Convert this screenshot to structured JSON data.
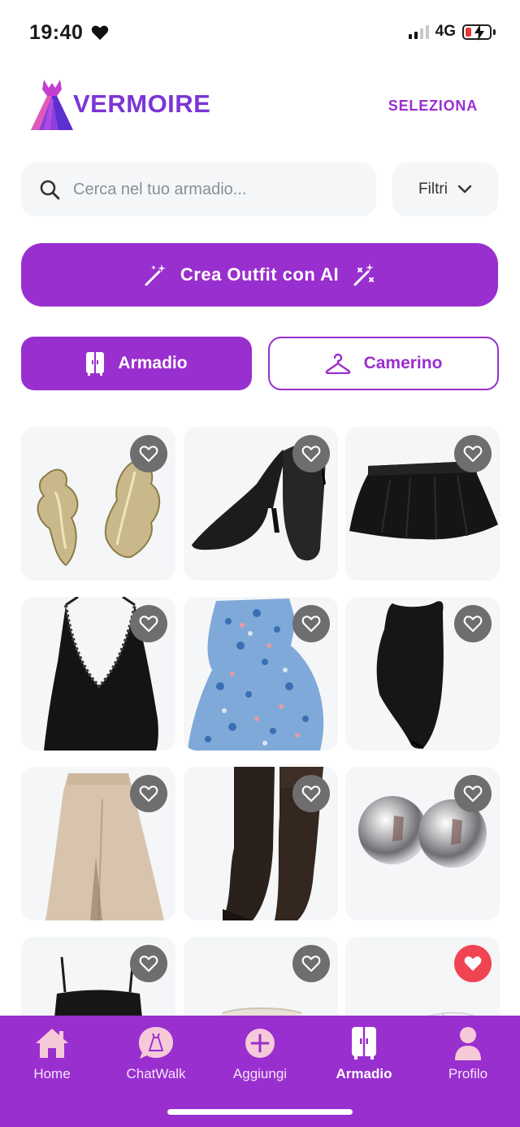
{
  "status_bar": {
    "time": "19:40",
    "network": "4G",
    "icons": [
      "heart-icon",
      "signal-icon",
      "battery-charging-icon"
    ]
  },
  "header": {
    "brand": "VERMOIRE",
    "select_label": "SELEZIONA"
  },
  "search": {
    "placeholder": "Cerca nel tuo armadio...",
    "value": ""
  },
  "filters": {
    "label": "Filtri"
  },
  "ai_button": {
    "label": "Crea Outfit con AI"
  },
  "segments": {
    "armadio": "Armadio",
    "camerino": "Camerino",
    "selected": "Armadio"
  },
  "items": [
    {
      "name": "gold-earrings",
      "favorite": false
    },
    {
      "name": "black-pumps",
      "favorite": false
    },
    {
      "name": "black-skirt",
      "favorite": false
    },
    {
      "name": "black-lace-top",
      "favorite": false
    },
    {
      "name": "blue-floral-dress",
      "favorite": false
    },
    {
      "name": "black-bodysuit",
      "favorite": false
    },
    {
      "name": "beige-skirt",
      "favorite": false
    },
    {
      "name": "brown-boots",
      "favorite": false
    },
    {
      "name": "silver-earrings",
      "favorite": false
    },
    {
      "name": "black-top",
      "favorite": false
    },
    {
      "name": "white-skirt",
      "favorite": false
    },
    {
      "name": "white-sneakers",
      "favorite": true
    }
  ],
  "nav": {
    "items": [
      {
        "label": "Home",
        "icon": "home-icon"
      },
      {
        "label": "ChatWalk",
        "icon": "chat-dress-icon"
      },
      {
        "label": "Aggiungi",
        "icon": "plus-icon"
      },
      {
        "label": "Armadio",
        "icon": "wardrobe-icon"
      },
      {
        "label": "Profilo",
        "icon": "profile-icon"
      }
    ],
    "active": "Armadio"
  },
  "colors": {
    "accent": "#9a2fcf",
    "brand_text": "#7b35d6",
    "favorite_active": "#f04452",
    "card_bg": "#f4f6f8"
  }
}
